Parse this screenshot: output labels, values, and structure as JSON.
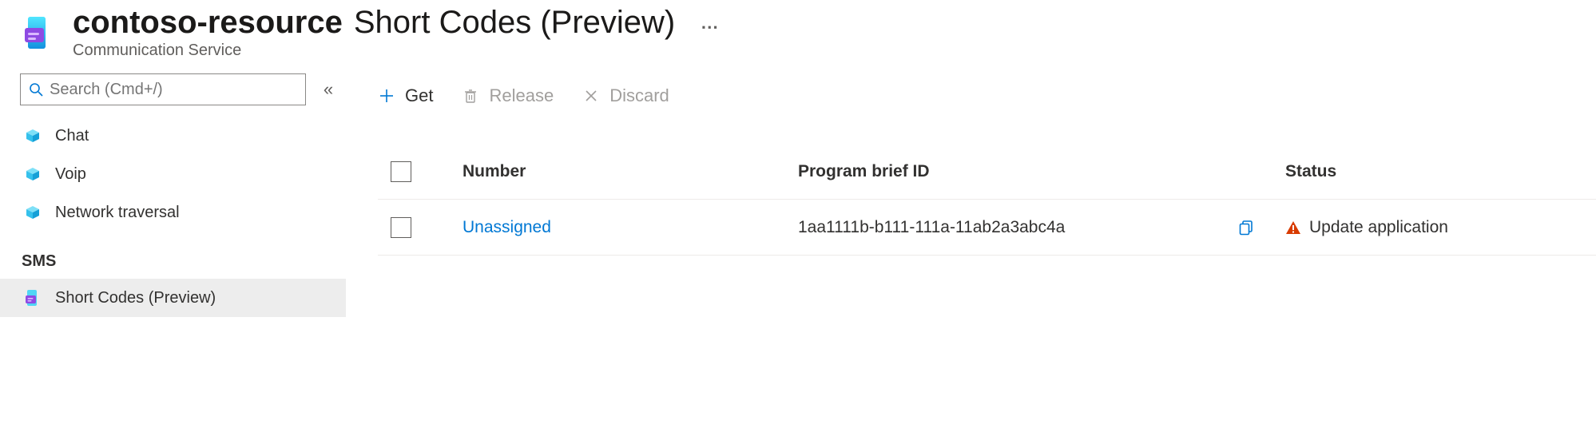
{
  "header": {
    "resource_name": "contoso-resource",
    "blade_title": "Short Codes (Preview)",
    "service_type": "Communication Service"
  },
  "sidebar": {
    "search_placeholder": "Search (Cmd+/)",
    "items": [
      {
        "label": "Chat"
      },
      {
        "label": "Voip"
      },
      {
        "label": "Network traversal"
      }
    ],
    "section_label": "SMS",
    "sms_items": [
      {
        "label": "Short Codes (Preview)",
        "selected": true
      }
    ]
  },
  "toolbar": {
    "get_label": "Get",
    "release_label": "Release",
    "discard_label": "Discard"
  },
  "table": {
    "columns": {
      "number": "Number",
      "program_brief_id": "Program brief ID",
      "status": "Status"
    },
    "rows": [
      {
        "number": "Unassigned",
        "program_brief_id": "1aa1111b-b111-111a-11ab2a3abc4a",
        "status": "Update application"
      }
    ]
  }
}
